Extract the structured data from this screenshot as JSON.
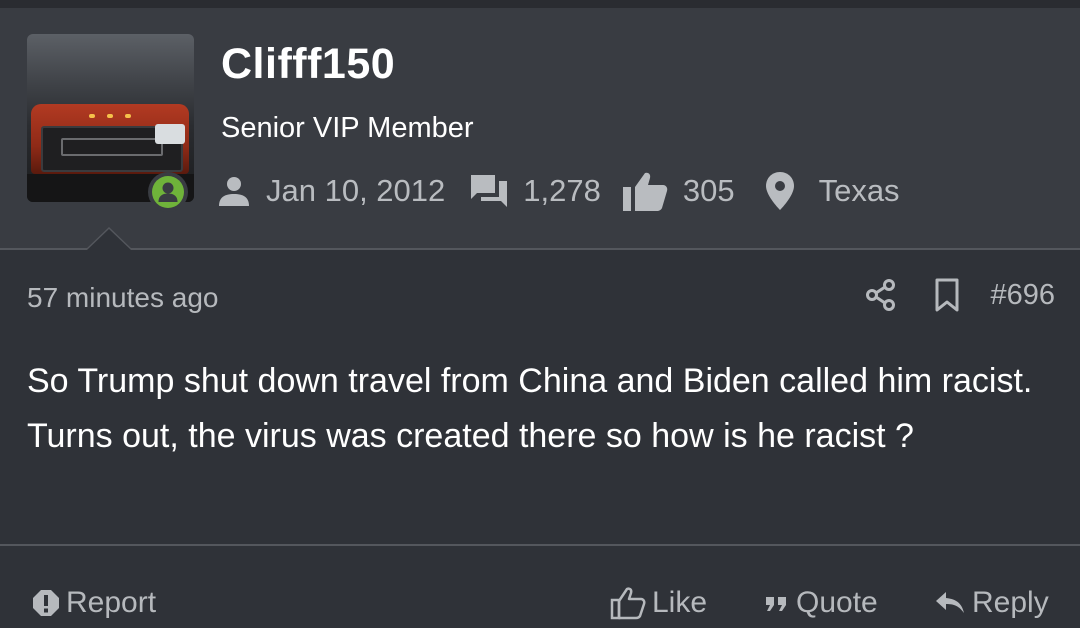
{
  "user": {
    "name": "Clifff150",
    "title": "Senior VIP Member",
    "joined": "Jan 10, 2012",
    "messages": "1,278",
    "reactions": "305",
    "location": "Texas",
    "online": true
  },
  "post": {
    "time": "57 minutes ago",
    "number": "#696",
    "body": "So Trump shut down travel from China and Biden called him racist. Turns out, the virus was created there so how is he racist ?"
  },
  "actions": {
    "report": "Report",
    "like": "Like",
    "quote": "Quote",
    "reply": "Reply"
  },
  "icons": {
    "joined": "user-icon",
    "messages": "messages-icon",
    "reactions": "thumbs-up-icon",
    "location": "map-pin-icon",
    "share": "share-icon",
    "bookmark": "bookmark-icon",
    "report": "report-icon",
    "like": "like-icon",
    "quote": "quote-icon",
    "reply": "reply-icon"
  },
  "colors": {
    "online": "#6fb33a",
    "background": "#2f3238",
    "panel": "#393c42"
  }
}
